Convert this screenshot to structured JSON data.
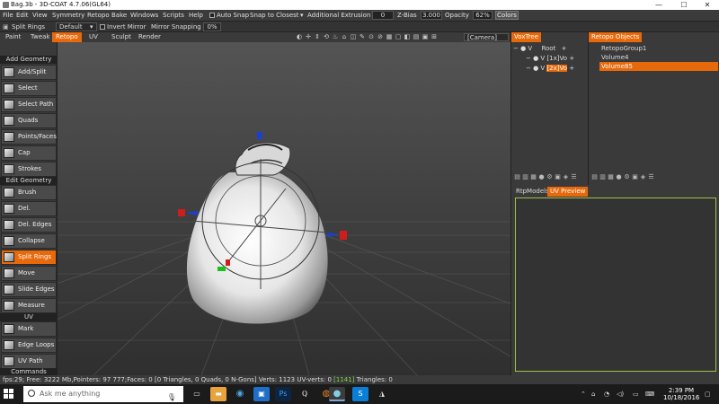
{
  "window": {
    "title": "Bag.3b - 3D-COAT 4.7.06(GL64)",
    "minimize": "—",
    "maximize": "☐",
    "close": "✕"
  },
  "menubar": {
    "items": [
      "File",
      "Edit",
      "View",
      "Symmetry",
      "Retopo",
      "Bake",
      "Windows",
      "Scripts",
      "Help"
    ],
    "auto_snap": "Auto Snap",
    "snap_to_closest": "Snap to Closest",
    "additional_extrusion": "Additional Extrusion",
    "extrusion_value": "0",
    "z_bias": "Z-Bias",
    "z_bias_value": "3.000",
    "opacity": "Opacity",
    "opacity_value": "62%",
    "colors": "Colors"
  },
  "toolbar": {
    "tool_name": "Split Rings",
    "preset": "Default",
    "invert_mirror": "Invert Mirror",
    "mirror_snapping": "Mirror Snapping",
    "mirror_snapping_value": "0%"
  },
  "room_tabs": [
    "Paint",
    "Tweak",
    "Retopo",
    "UV",
    "Sculpt",
    "Render"
  ],
  "camera": "[Camera]",
  "left_panel": {
    "add_geometry": "Add Geometry",
    "edit_geometry": "Edit Geometry",
    "uv": "UV",
    "commands": "Commands",
    "tools_add": [
      "Add/Split",
      "Select",
      "Select Path",
      "Quads",
      "Points/Faces",
      "Cap",
      "Strokes"
    ],
    "tools_edit": [
      "Brush",
      "Del. Polygons",
      "Del. Edges",
      "Collapse",
      "Split Rings",
      "Move",
      "Slide Edges",
      "Measure"
    ],
    "tools_uv": [
      "Mark Seams",
      "Edge Loops",
      "UV Path"
    ]
  },
  "voxtree": {
    "title": "VoxTree",
    "rows": [
      {
        "prefix": "−  ●  V",
        "label": "Root",
        "plus": "+"
      },
      {
        "prefix": "−  ●  V",
        "label": "[1x]Vo",
        "plus": "+"
      },
      {
        "prefix": "−  ●  V",
        "label": "[2x]Vo",
        "plus": "+"
      }
    ]
  },
  "retopo_objects": {
    "title": "Retopo Objects",
    "rows": [
      "RetopoGroup1",
      "Volume4",
      "Volume85"
    ]
  },
  "preview_tabs": [
    "RtpModels",
    "UV Preview"
  ],
  "status": {
    "prefix": "fps:29;   Free: 3222 Mb,Pointers: 97 777;Faces: 0 [0 Triangles, 0 Quads, 0 N-Gons] Verts: 1123  UV-verts: 0 ",
    "highlight": "[1141]",
    "suffix": " Triangles: 0"
  },
  "taskbar": {
    "search_placeholder": "Ask me anything",
    "time": "2:39 PM",
    "date": "10/18/2016"
  },
  "colors": {
    "accent": "#e8690b",
    "preview_border": "#a0c04a",
    "status_highlight": "#6fdc4a"
  }
}
